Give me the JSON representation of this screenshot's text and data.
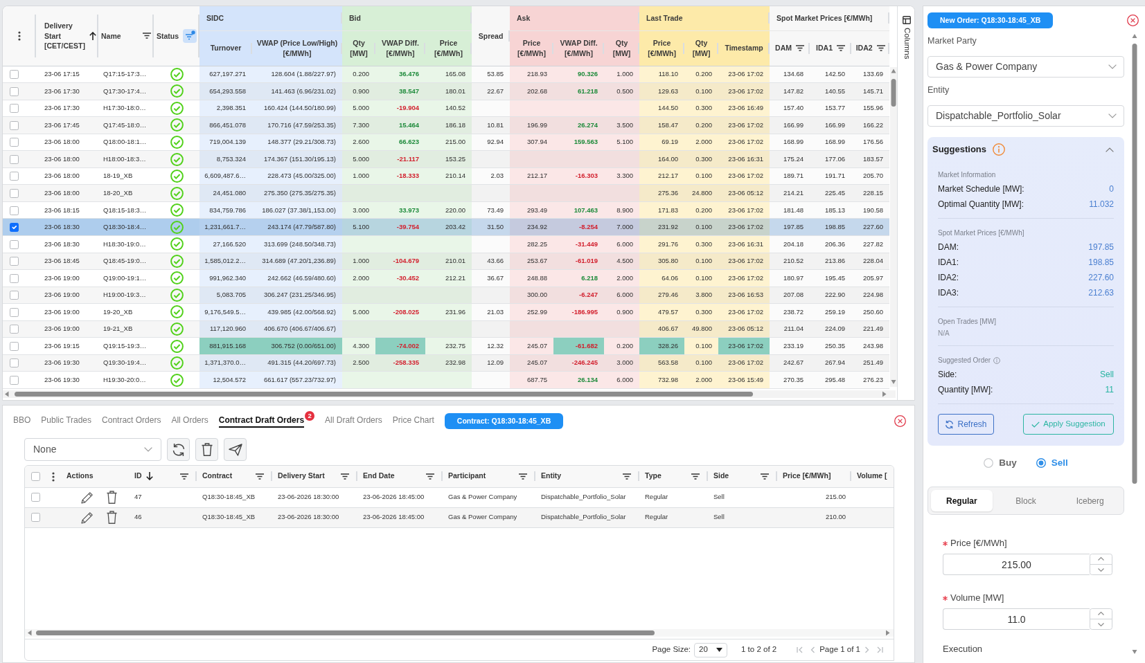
{
  "market_table": {
    "lead_columns": [
      {
        "label": "Delivery Start [CET/CEST]",
        "sort_ascending": true,
        "sort_descending": false,
        "filter": false,
        "filter_active": false
      },
      {
        "label": "Name",
        "sort_ascending": false,
        "sort_descending": false,
        "filter": true,
        "filter_active": false
      },
      {
        "label": "Status",
        "sort_ascending": false,
        "sort_descending": false,
        "filter": true,
        "filter_active": true
      }
    ],
    "column_groups": [
      {
        "kind": "group",
        "label": "SIDC",
        "color": "#d4e4fb",
        "columns": [
          {
            "label": "Turnover",
            "filter": false
          },
          {
            "label": "VWAP (Price Low/High) [€/MWh]",
            "filter": false
          }
        ]
      },
      {
        "kind": "group",
        "label": "Bid",
        "color": "#d7efd6",
        "columns": [
          {
            "label": "Qty [MW]",
            "filter": false
          },
          {
            "label": "VWAP Diff. [€/MWh]",
            "filter": false
          },
          {
            "label": "Price [€/MWh]",
            "filter": false
          }
        ]
      },
      {
        "kind": "single",
        "label": "Spread",
        "color": "#f7f7f7",
        "filter": false
      },
      {
        "kind": "group",
        "label": "Ask",
        "color": "#f7d4d4",
        "columns": [
          {
            "label": "Price [€/MWh]",
            "filter": false
          },
          {
            "label": "VWAP Diff. [€/MWh]",
            "filter": false
          },
          {
            "label": "Qty [MW]",
            "filter": false
          }
        ]
      },
      {
        "kind": "group",
        "label": "Last Trade",
        "color": "#fdeaa9",
        "columns": [
          {
            "label": "Price [€/MWh]",
            "filter": false
          },
          {
            "label": "Qty [MW]",
            "filter": false
          },
          {
            "label": "Timestamp",
            "filter": false
          }
        ]
      },
      {
        "kind": "group",
        "label": "Spot Market Prices [€/MWh]",
        "color": "#f7f7f7",
        "columns": [
          {
            "label": "DAM",
            "filter": true
          },
          {
            "label": "IDA1",
            "filter": true
          },
          {
            "label": "IDA2",
            "filter": true
          }
        ]
      }
    ],
    "rows": [
      {
        "selected": false,
        "delivery_start": "23-06 17:15",
        "name": "Q17:15-17:3…",
        "status_ok": true,
        "cells": [
          {
            "text": "627,197.271",
            "highlighted": false
          },
          {
            "text": "128.604 (1.88/227.97)",
            "highlighted": false
          },
          {
            "text": "0.200",
            "highlighted": false
          },
          {
            "text": "36.476",
            "positive": true,
            "highlighted": false
          },
          {
            "text": "165.08",
            "highlighted": false
          },
          {
            "text": "53.85",
            "highlighted": false
          },
          {
            "text": "218.93",
            "highlighted": false
          },
          {
            "text": "90.326",
            "positive": true,
            "highlighted": false
          },
          {
            "text": "1.000",
            "highlighted": false
          },
          {
            "text": "118.10",
            "highlighted": false
          },
          {
            "text": "0.200",
            "highlighted": false
          },
          {
            "text": "23-06 17:02",
            "highlighted": false
          },
          {
            "text": "134.68",
            "highlighted": false
          },
          {
            "text": "142.50",
            "highlighted": false
          },
          {
            "text": "133.69",
            "highlighted": false
          }
        ]
      },
      {
        "selected": false,
        "delivery_start": "23-06 17:30",
        "name": "Q17:30-17:4…",
        "status_ok": true,
        "cells": [
          {
            "text": "654,293.558",
            "highlighted": false
          },
          {
            "text": "141.463 (6.96/231.02)",
            "highlighted": false
          },
          {
            "text": "0.900",
            "highlighted": false
          },
          {
            "text": "38.547",
            "positive": true,
            "highlighted": false
          },
          {
            "text": "180.01",
            "highlighted": false
          },
          {
            "text": "22.67",
            "highlighted": false
          },
          {
            "text": "202.68",
            "highlighted": false
          },
          {
            "text": "61.218",
            "positive": true,
            "highlighted": false
          },
          {
            "text": "0.500",
            "highlighted": false
          },
          {
            "text": "129.63",
            "highlighted": false
          },
          {
            "text": "0.100",
            "highlighted": false
          },
          {
            "text": "23-06 17:02",
            "highlighted": false
          },
          {
            "text": "147.82",
            "highlighted": false
          },
          {
            "text": "140.55",
            "highlighted": false
          },
          {
            "text": "145.71",
            "highlighted": false
          }
        ]
      },
      {
        "selected": false,
        "delivery_start": "23-06 17:30",
        "name": "H17:30-18:0…",
        "status_ok": true,
        "cells": [
          {
            "text": "2,398.351",
            "highlighted": false
          },
          {
            "text": "160.424 (144.50/180.99)",
            "highlighted": false
          },
          {
            "text": "5.000",
            "highlighted": false
          },
          {
            "text": "-19.904",
            "positive": false,
            "highlighted": false
          },
          {
            "text": "140.52",
            "highlighted": false
          },
          {
            "highlighted": false
          },
          {
            "highlighted": false
          },
          {
            "highlighted": false
          },
          {
            "highlighted": false
          },
          {
            "text": "144.50",
            "highlighted": false
          },
          {
            "text": "0.300",
            "highlighted": false
          },
          {
            "text": "23-06 16:49",
            "highlighted": false
          },
          {
            "text": "157.40",
            "highlighted": false
          },
          {
            "text": "153.77",
            "highlighted": false
          },
          {
            "text": "155.96",
            "highlighted": false
          }
        ]
      },
      {
        "selected": false,
        "delivery_start": "23-06 17:45",
        "name": "Q17:45-18:0…",
        "status_ok": true,
        "cells": [
          {
            "text": "866,451.078",
            "highlighted": false
          },
          {
            "text": "170.716 (47.59/253.35)",
            "highlighted": false
          },
          {
            "text": "7.300",
            "highlighted": false
          },
          {
            "text": "15.464",
            "positive": true,
            "highlighted": false
          },
          {
            "text": "186.18",
            "highlighted": false
          },
          {
            "text": "10.81",
            "highlighted": false
          },
          {
            "text": "196.99",
            "highlighted": false
          },
          {
            "text": "26.274",
            "positive": true,
            "highlighted": false
          },
          {
            "text": "3.500",
            "highlighted": false
          },
          {
            "text": "158.47",
            "highlighted": false
          },
          {
            "text": "0.200",
            "highlighted": false
          },
          {
            "text": "23-06 17:02",
            "highlighted": false
          },
          {
            "text": "166.99",
            "highlighted": false
          },
          {
            "text": "166.99",
            "highlighted": false
          },
          {
            "text": "166.22",
            "highlighted": false
          }
        ]
      },
      {
        "selected": false,
        "delivery_start": "23-06 18:00",
        "name": "Q18:00-18:1…",
        "status_ok": true,
        "cells": [
          {
            "text": "719,004.139",
            "highlighted": false
          },
          {
            "text": "148.377 (29.21/308.73)",
            "highlighted": false
          },
          {
            "text": "2.600",
            "highlighted": false
          },
          {
            "text": "66.623",
            "positive": true,
            "highlighted": false
          },
          {
            "text": "215.00",
            "highlighted": false
          },
          {
            "text": "92.94",
            "highlighted": false
          },
          {
            "text": "307.94",
            "highlighted": false
          },
          {
            "text": "159.563",
            "positive": true,
            "highlighted": false
          },
          {
            "text": "5.100",
            "highlighted": false
          },
          {
            "text": "69.19",
            "highlighted": false
          },
          {
            "text": "2.000",
            "highlighted": false
          },
          {
            "text": "23-06 17:02",
            "highlighted": false
          },
          {
            "text": "168.99",
            "highlighted": false
          },
          {
            "text": "168.99",
            "highlighted": false
          },
          {
            "text": "176.56",
            "highlighted": false
          }
        ]
      },
      {
        "selected": false,
        "delivery_start": "23-06 18:00",
        "name": "H18:00-18:3…",
        "status_ok": true,
        "cells": [
          {
            "text": "8,753.324",
            "highlighted": false
          },
          {
            "text": "174.367 (151.30/195.13)",
            "highlighted": false
          },
          {
            "text": "5.000",
            "highlighted": false
          },
          {
            "text": "-21.117",
            "positive": false,
            "highlighted": false
          },
          {
            "text": "153.25",
            "highlighted": false
          },
          {
            "highlighted": false
          },
          {
            "highlighted": false
          },
          {
            "highlighted": false
          },
          {
            "highlighted": false
          },
          {
            "text": "164.00",
            "highlighted": false
          },
          {
            "text": "0.300",
            "highlighted": false
          },
          {
            "text": "23-06 16:31",
            "highlighted": false
          },
          {
            "text": "175.24",
            "highlighted": false
          },
          {
            "text": "177.06",
            "highlighted": false
          },
          {
            "text": "183.57",
            "highlighted": false
          }
        ]
      },
      {
        "selected": false,
        "delivery_start": "23-06 18:00",
        "name": "18-19_XB",
        "status_ok": true,
        "cells": [
          {
            "text": "6,609,487.6…",
            "highlighted": false
          },
          {
            "text": "228.473 (45.00/325.00)",
            "highlighted": false
          },
          {
            "text": "1.000",
            "highlighted": false
          },
          {
            "text": "-18.333",
            "positive": false,
            "highlighted": false
          },
          {
            "text": "210.14",
            "highlighted": false
          },
          {
            "text": "2.03",
            "highlighted": false
          },
          {
            "text": "212.17",
            "highlighted": false
          },
          {
            "text": "-16.303",
            "positive": false,
            "highlighted": false
          },
          {
            "text": "3.300",
            "highlighted": false
          },
          {
            "text": "212.17",
            "highlighted": false
          },
          {
            "text": "0.100",
            "highlighted": false
          },
          {
            "text": "23-06 17:02",
            "highlighted": false
          },
          {
            "text": "189.71",
            "highlighted": false
          },
          {
            "text": "191.71",
            "highlighted": false
          },
          {
            "text": "205.70",
            "highlighted": false
          }
        ]
      },
      {
        "selected": false,
        "delivery_start": "23-06 18:00",
        "name": "18-20_XB",
        "status_ok": true,
        "cells": [
          {
            "text": "24,451.080",
            "highlighted": false
          },
          {
            "text": "275.350 (275.35/275.35)",
            "highlighted": false
          },
          {
            "highlighted": false
          },
          {
            "highlighted": false
          },
          {
            "highlighted": false
          },
          {
            "highlighted": false
          },
          {
            "highlighted": false
          },
          {
            "highlighted": false
          },
          {
            "highlighted": false
          },
          {
            "text": "275.36",
            "highlighted": false
          },
          {
            "text": "24.800",
            "highlighted": false
          },
          {
            "text": "23-06 05:12",
            "highlighted": false
          },
          {
            "text": "214.21",
            "highlighted": false
          },
          {
            "text": "225.45",
            "highlighted": false
          },
          {
            "text": "228.15",
            "highlighted": false
          }
        ]
      },
      {
        "selected": false,
        "delivery_start": "23-06 18:15",
        "name": "Q18:15-18:3…",
        "status_ok": true,
        "cells": [
          {
            "text": "834,759.786",
            "highlighted": false
          },
          {
            "text": "186.027 (37.38/1,153.00)",
            "highlighted": false
          },
          {
            "text": "3.000",
            "highlighted": false
          },
          {
            "text": "33.973",
            "positive": true,
            "highlighted": false
          },
          {
            "text": "220.00",
            "highlighted": false
          },
          {
            "text": "73.49",
            "highlighted": false
          },
          {
            "text": "293.49",
            "highlighted": false
          },
          {
            "text": "107.463",
            "positive": true,
            "highlighted": false
          },
          {
            "text": "8.900",
            "highlighted": false
          },
          {
            "text": "171.83",
            "highlighted": false
          },
          {
            "text": "0.200",
            "highlighted": false
          },
          {
            "text": "23-06 17:02",
            "highlighted": false
          },
          {
            "text": "181.48",
            "highlighted": false
          },
          {
            "text": "185.13",
            "highlighted": false
          },
          {
            "text": "190.58",
            "highlighted": false
          }
        ]
      },
      {
        "selected": true,
        "delivery_start": "23-06 18:30",
        "name": "Q18:30-18:4…",
        "status_ok": true,
        "cells": [
          {
            "text": "1,231,661.7…",
            "highlighted": false
          },
          {
            "text": "243.174 (47.79/587.80)",
            "highlighted": false
          },
          {
            "text": "5.100",
            "highlighted": false
          },
          {
            "text": "-39.754",
            "positive": false,
            "highlighted": false
          },
          {
            "text": "203.42",
            "highlighted": false
          },
          {
            "text": "31.50",
            "highlighted": false
          },
          {
            "text": "234.92",
            "highlighted": false
          },
          {
            "text": "-8.254",
            "positive": false,
            "highlighted": false
          },
          {
            "text": "7.000",
            "highlighted": false
          },
          {
            "text": "231.92",
            "highlighted": false
          },
          {
            "text": "0.100",
            "highlighted": false
          },
          {
            "text": "23-06 17:02",
            "highlighted": false
          },
          {
            "text": "197.85",
            "highlighted": false
          },
          {
            "text": "198.85",
            "highlighted": false
          },
          {
            "text": "227.60",
            "highlighted": false
          }
        ]
      },
      {
        "selected": false,
        "delivery_start": "23-06 18:30",
        "name": "H18:30-19:0…",
        "status_ok": true,
        "cells": [
          {
            "text": "27,166.520",
            "highlighted": false
          },
          {
            "text": "313.699 (248.50/348.73)",
            "highlighted": false
          },
          {
            "highlighted": false
          },
          {
            "highlighted": false
          },
          {
            "highlighted": false
          },
          {
            "highlighted": false
          },
          {
            "text": "282.25",
            "highlighted": false
          },
          {
            "text": "-31.449",
            "positive": false,
            "highlighted": false
          },
          {
            "text": "6.000",
            "highlighted": false
          },
          {
            "text": "291.76",
            "highlighted": false
          },
          {
            "text": "0.300",
            "highlighted": false
          },
          {
            "text": "23-06 16:31",
            "highlighted": false
          },
          {
            "text": "204.18",
            "highlighted": false
          },
          {
            "text": "206.36",
            "highlighted": false
          },
          {
            "text": "227.82",
            "highlighted": false
          }
        ]
      },
      {
        "selected": false,
        "delivery_start": "23-06 18:45",
        "name": "Q18:45-19:0…",
        "status_ok": true,
        "cells": [
          {
            "text": "1,585,012.2…",
            "highlighted": false
          },
          {
            "text": "314.689 (47.20/1,236.89)",
            "highlighted": false
          },
          {
            "text": "1.000",
            "highlighted": false
          },
          {
            "text": "-104.679",
            "positive": false,
            "highlighted": false
          },
          {
            "text": "210.01",
            "highlighted": false
          },
          {
            "text": "43.66",
            "highlighted": false
          },
          {
            "text": "253.67",
            "highlighted": false
          },
          {
            "text": "-61.019",
            "positive": false,
            "highlighted": false
          },
          {
            "text": "4.500",
            "highlighted": false
          },
          {
            "text": "305.80",
            "highlighted": false
          },
          {
            "text": "0.100",
            "highlighted": false
          },
          {
            "text": "23-06 17:02",
            "highlighted": false
          },
          {
            "text": "210.52",
            "highlighted": false
          },
          {
            "text": "213.86",
            "highlighted": false
          },
          {
            "text": "228.04",
            "highlighted": false
          }
        ]
      },
      {
        "selected": false,
        "delivery_start": "23-06 19:00",
        "name": "Q19:00-19:1…",
        "status_ok": true,
        "cells": [
          {
            "text": "991,962.340",
            "highlighted": false
          },
          {
            "text": "242.662 (46.59/480.60)",
            "highlighted": false
          },
          {
            "text": "2.000",
            "highlighted": false
          },
          {
            "text": "-30.452",
            "positive": false,
            "highlighted": false
          },
          {
            "text": "212.21",
            "highlighted": false
          },
          {
            "text": "36.67",
            "highlighted": false
          },
          {
            "text": "248.88",
            "highlighted": false
          },
          {
            "text": "6.218",
            "positive": true,
            "highlighted": false
          },
          {
            "text": "2.000",
            "highlighted": false
          },
          {
            "text": "64.06",
            "highlighted": false
          },
          {
            "text": "0.100",
            "highlighted": false
          },
          {
            "text": "23-06 17:02",
            "highlighted": false
          },
          {
            "text": "180.97",
            "highlighted": false
          },
          {
            "text": "195.45",
            "highlighted": false
          },
          {
            "text": "205.97",
            "highlighted": false
          }
        ]
      },
      {
        "selected": false,
        "delivery_start": "23-06 19:00",
        "name": "H19:00-19:3…",
        "status_ok": true,
        "cells": [
          {
            "text": "5,083.705",
            "highlighted": false
          },
          {
            "text": "306.247 (231.25/346.95)",
            "highlighted": false
          },
          {
            "highlighted": false
          },
          {
            "highlighted": false
          },
          {
            "highlighted": false
          },
          {
            "highlighted": false
          },
          {
            "text": "300.00",
            "highlighted": false
          },
          {
            "text": "-6.247",
            "positive": false,
            "highlighted": false
          },
          {
            "text": "6.000",
            "highlighted": false
          },
          {
            "text": "279.46",
            "highlighted": false
          },
          {
            "text": "3.800",
            "highlighted": false
          },
          {
            "text": "23-06 16:53",
            "highlighted": false
          },
          {
            "text": "207.08",
            "highlighted": false
          },
          {
            "text": "222.90",
            "highlighted": false
          },
          {
            "text": "224.98",
            "highlighted": false
          }
        ]
      },
      {
        "selected": false,
        "delivery_start": "23-06 19:00",
        "name": "19-20_XB",
        "status_ok": true,
        "cells": [
          {
            "text": "9,176,549.5…",
            "highlighted": false
          },
          {
            "text": "439.985 (42.00/568.92)",
            "highlighted": false
          },
          {
            "text": "5.000",
            "highlighted": false
          },
          {
            "text": "-208.025",
            "positive": false,
            "highlighted": false
          },
          {
            "text": "231.96",
            "highlighted": false
          },
          {
            "text": "21.03",
            "highlighted": false
          },
          {
            "text": "252.99",
            "highlighted": false
          },
          {
            "text": "-186.995",
            "positive": false,
            "highlighted": false
          },
          {
            "text": "0.900",
            "highlighted": false
          },
          {
            "text": "479.57",
            "highlighted": false
          },
          {
            "text": "0.300",
            "highlighted": false
          },
          {
            "text": "23-06 17:02",
            "highlighted": false
          },
          {
            "text": "238.72",
            "highlighted": false
          },
          {
            "text": "259.19",
            "highlighted": false
          },
          {
            "text": "250.60",
            "highlighted": false
          }
        ]
      },
      {
        "selected": false,
        "delivery_start": "23-06 19:00",
        "name": "19-21_XB",
        "status_ok": true,
        "cells": [
          {
            "text": "117,120.960",
            "highlighted": false
          },
          {
            "text": "406.670 (406.67/406.67)",
            "highlighted": false
          },
          {
            "highlighted": false
          },
          {
            "highlighted": false
          },
          {
            "highlighted": false
          },
          {
            "highlighted": false
          },
          {
            "highlighted": false
          },
          {
            "highlighted": false
          },
          {
            "highlighted": false
          },
          {
            "text": "406.67",
            "highlighted": false
          },
          {
            "text": "49.800",
            "highlighted": false
          },
          {
            "text": "23-06 05:12",
            "highlighted": false
          },
          {
            "text": "211.04",
            "highlighted": false
          },
          {
            "text": "224.09",
            "highlighted": false
          },
          {
            "text": "221.49",
            "highlighted": false
          }
        ]
      },
      {
        "selected": false,
        "delivery_start": "23-06 19:15",
        "name": "Q19:15-19:3…",
        "status_ok": true,
        "cells": [
          {
            "text": "881,915.168",
            "highlighted": true
          },
          {
            "text": "306.752 (0.00/651.00)",
            "highlighted": true
          },
          {
            "text": "4.300",
            "highlighted": false
          },
          {
            "text": "-74.002",
            "positive": false,
            "highlighted": true
          },
          {
            "text": "232.75",
            "highlighted": false
          },
          {
            "text": "12.32",
            "highlighted": false
          },
          {
            "text": "245.07",
            "highlighted": false
          },
          {
            "text": "-61.682",
            "positive": false,
            "highlighted": true
          },
          {
            "text": "0.200",
            "highlighted": false
          },
          {
            "text": "328.26",
            "highlighted": true
          },
          {
            "text": "0.100",
            "highlighted": false
          },
          {
            "text": "23-06 17:02",
            "highlighted": true
          },
          {
            "text": "233.19",
            "highlighted": false
          },
          {
            "text": "250.35",
            "highlighted": false
          },
          {
            "text": "243.98",
            "highlighted": false
          }
        ]
      },
      {
        "selected": false,
        "delivery_start": "23-06 19:30",
        "name": "Q19:30-19:4…",
        "status_ok": true,
        "cells": [
          {
            "text": "1,371,370.0…",
            "highlighted": false
          },
          {
            "text": "491.315 (44.20/697.73)",
            "highlighted": false
          },
          {
            "text": "2.500",
            "highlighted": false
          },
          {
            "text": "-258.335",
            "positive": false,
            "highlighted": false
          },
          {
            "text": "232.98",
            "highlighted": false
          },
          {
            "text": "12.09",
            "highlighted": false
          },
          {
            "text": "245.07",
            "highlighted": false
          },
          {
            "text": "-246.245",
            "positive": false,
            "highlighted": false
          },
          {
            "text": "3.000",
            "highlighted": false
          },
          {
            "text": "563.58",
            "highlighted": false
          },
          {
            "text": "0.100",
            "highlighted": false
          },
          {
            "text": "23-06 17:02",
            "highlighted": false
          },
          {
            "text": "242.67",
            "highlighted": false
          },
          {
            "text": "267.94",
            "highlighted": false
          },
          {
            "text": "251.49",
            "highlighted": false
          }
        ]
      },
      {
        "selected": false,
        "delivery_start": "23-06 19:30",
        "name": "H19:30-20:0…",
        "status_ok": true,
        "cells": [
          {
            "text": "12,504.572",
            "highlighted": false
          },
          {
            "text": "661.617 (557.23/732.97)",
            "highlighted": false
          },
          {
            "highlighted": false
          },
          {
            "highlighted": false
          },
          {
            "highlighted": false
          },
          {
            "highlighted": false
          },
          {
            "text": "687.75",
            "highlighted": false
          },
          {
            "text": "26.134",
            "positive": true,
            "highlighted": false
          },
          {
            "text": "6.000",
            "highlighted": false
          },
          {
            "text": "732.98",
            "highlighted": false
          },
          {
            "text": "2.000",
            "highlighted": false
          },
          {
            "text": "23-06 15:49",
            "highlighted": false
          },
          {
            "text": "270.35",
            "highlighted": false
          },
          {
            "text": "295.48",
            "highlighted": false
          },
          {
            "text": "276.23",
            "highlighted": false
          }
        ]
      }
    ],
    "side_tab": "Columns"
  },
  "orders_panel": {
    "tabs": [
      {
        "label": "BBO",
        "selected": false
      },
      {
        "label": "Public Trades",
        "selected": false
      },
      {
        "label": "Contract Orders",
        "selected": false
      },
      {
        "label": "All Orders",
        "selected": false
      },
      {
        "label": "Contract Draft Orders",
        "selected": true,
        "badge": "2"
      },
      {
        "label": "All Draft Orders",
        "selected": false
      },
      {
        "label": "Price Chart",
        "selected": false
      }
    ],
    "contract_chip": "Contract: Q18:30-18:45_XB",
    "preset_select": {
      "value": "None"
    },
    "grid": {
      "select_all": {
        "checked": false
      },
      "columns": [
        {
          "kind": "actions",
          "label": "Actions",
          "sort_ascending": false,
          "sort_descending": false,
          "filter": false
        },
        {
          "kind": "data",
          "label": "ID",
          "sort_ascending": false,
          "sort_descending": true,
          "filter": true
        },
        {
          "kind": "data",
          "label": "Contract",
          "sort_ascending": false,
          "sort_descending": false,
          "filter": true
        },
        {
          "kind": "data",
          "label": "Delivery Start",
          "sort_ascending": false,
          "sort_descending": false,
          "filter": true
        },
        {
          "kind": "data",
          "label": "End Date",
          "sort_ascending": false,
          "sort_descending": false,
          "filter": true
        },
        {
          "kind": "data",
          "label": "Participant",
          "sort_ascending": false,
          "sort_descending": false,
          "filter": true
        },
        {
          "kind": "data",
          "label": "Entity",
          "sort_ascending": false,
          "sort_descending": false,
          "filter": true
        },
        {
          "kind": "data",
          "label": "Type",
          "sort_ascending": false,
          "sort_descending": false,
          "filter": true
        },
        {
          "kind": "data",
          "label": "Side",
          "sort_ascending": false,
          "sort_descending": false,
          "filter": true
        },
        {
          "kind": "data",
          "label": "Price [€/MWh]",
          "sort_ascending": false,
          "sort_descending": false,
          "filter": false
        },
        {
          "kind": "data",
          "label": "Volume [",
          "sort_ascending": false,
          "sort_descending": false,
          "filter": false
        }
      ],
      "rows": [
        {
          "selected": false,
          "cells": [
            "",
            "47",
            "Q18:30-18:45_XB",
            "23-06-2026 18:30:00",
            "23-06-2026 18:45:00",
            "Gas & Power Company",
            "Dispatchable_Portfolio_Solar",
            "Regular",
            "Sell",
            "215.00"
          ]
        },
        {
          "selected": false,
          "cells": [
            "",
            "46",
            "Q18:30-18:45_XB",
            "23-06-2026 18:30:00",
            "23-06-2026 18:45:00",
            "Gas & Power Company",
            "Dispatchable_Portfolio_Solar",
            "Regular",
            "Sell",
            "210.00"
          ]
        }
      ],
      "pagination": {
        "page_size_label": "Page Size:",
        "page_size": "20",
        "range": "1 to 2 of 2",
        "page": "Page 1 of 1"
      }
    }
  },
  "order_form": {
    "title_chip": "New Order: Q18:30-18:45_XB",
    "selects": [
      {
        "label": "Market Party",
        "value": "Gas & Power Company"
      },
      {
        "label": "Entity",
        "value": "Dispatchable_Portfolio_Solar"
      }
    ],
    "suggestions": {
      "title": "Suggestions",
      "expanded": true,
      "sections": [
        {
          "kind": "metrics",
          "title": "Market Information",
          "items": [
            {
              "label": "Market Schedule [MW]:",
              "value": "0"
            },
            {
              "label": "Optimal Quantity [MW]:",
              "value": "11.032"
            }
          ]
        },
        {
          "kind": "metrics",
          "title": "Spot Market Prices [€/MWh]",
          "items": [
            {
              "label": "DAM:",
              "value": "197.85"
            },
            {
              "label": "IDA1:",
              "value": "198.85"
            },
            {
              "label": "IDA2:",
              "value": "227.60"
            },
            {
              "label": "IDA3:",
              "value": "212.63"
            }
          ]
        },
        {
          "kind": "note",
          "title": "Open Trades [MW]",
          "text": "N/A"
        },
        {
          "kind": "order",
          "title": "Suggested Order",
          "items": [
            {
              "label": "Side:",
              "value": "Sell"
            },
            {
              "label": "Quantity [MW]:",
              "value": "11"
            }
          ]
        }
      ],
      "buttons": [
        {
          "kind": "refresh",
          "label": "Refresh"
        },
        {
          "kind": "apply",
          "label": "Apply Suggestion"
        }
      ]
    },
    "side_options": [
      {
        "label": "Buy",
        "selected": false
      },
      {
        "label": "Sell",
        "selected": true
      }
    ],
    "order_types": [
      {
        "label": "Regular",
        "selected": true
      },
      {
        "label": "Block",
        "selected": false
      },
      {
        "label": "Iceberg",
        "selected": false
      }
    ],
    "inputs": [
      {
        "label": "Price [€/MWh]",
        "required": true,
        "value": "215.00"
      },
      {
        "label": "Volume [MW]",
        "required": true,
        "value": "11.0"
      }
    ],
    "execution_label": "Execution"
  }
}
